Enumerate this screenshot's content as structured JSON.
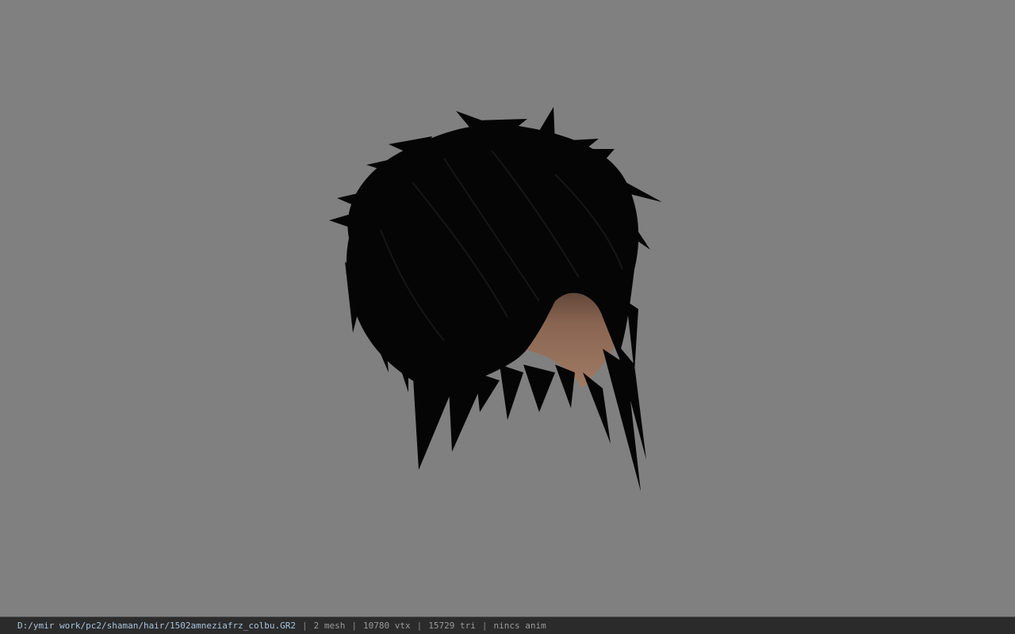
{
  "viewer": {
    "background_color": "#808080",
    "model_icon": "hair-mesh-render"
  },
  "status_bar": {
    "file_path": "D:/ymir work/pc2/shaman/hair/1502amneziafrz_colbu.GR2",
    "separator": "|",
    "mesh_count": "2 mesh",
    "vertex_count": "10780 vtx",
    "triangle_count": "15729 tri",
    "animation": "nincs anim"
  }
}
